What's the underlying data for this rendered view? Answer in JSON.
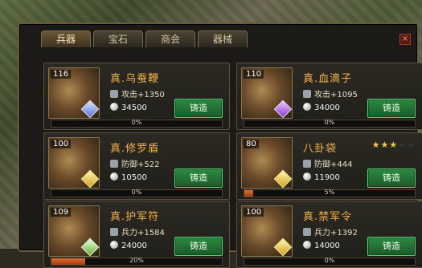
{
  "tabs": [
    "兵器",
    "宝石",
    "商会",
    "器械"
  ],
  "close_label": "×",
  "items": [
    {
      "level": "116",
      "name": "真.乌蚕鞭",
      "stat": "攻击+1350",
      "cost": "34500",
      "button": "铸造",
      "progress": 0,
      "progress_text": "0%",
      "gem": "b"
    },
    {
      "level": "110",
      "name": "真.血滴子",
      "stat": "攻击+1095",
      "cost": "34000",
      "button": "铸造",
      "progress": 0,
      "progress_text": "0%",
      "gem": "p"
    },
    {
      "level": "100",
      "name": "真.修罗盾",
      "stat": "防御+522",
      "cost": "10500",
      "button": "铸造",
      "progress": 0,
      "progress_text": "0%",
      "gem": "y"
    },
    {
      "level": "80",
      "name": "八卦袋",
      "stat": "防御+444",
      "cost": "11900",
      "button": "铸造",
      "progress": 5,
      "progress_text": "5%",
      "gem": "y",
      "stars": {
        "filled": 3,
        "total": 5
      }
    },
    {
      "level": "109",
      "name": "真.护军符",
      "stat": "兵力+1584",
      "cost": "24000",
      "button": "铸造",
      "progress": 20,
      "progress_text": "20%",
      "gem": "g"
    },
    {
      "level": "100",
      "name": "真.禁军令",
      "stat": "兵力+1392",
      "cost": "14000",
      "button": "铸造",
      "progress": 0,
      "progress_text": "0%",
      "gem": "y"
    }
  ]
}
